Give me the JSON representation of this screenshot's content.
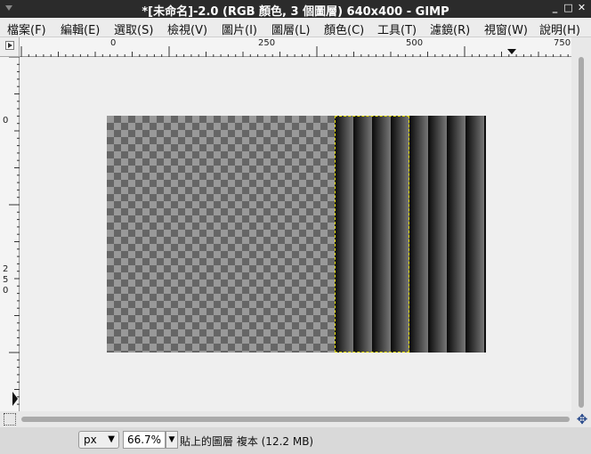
{
  "window": {
    "title": "*[未命名]-2.0 (RGB 顏色, 3 個圖層) 640x400 - GIMP",
    "controls": [
      "_",
      "□",
      "✕"
    ]
  },
  "menu": [
    "檔案(F)",
    "編輯(E)",
    "選取(S)",
    "檢視(V)",
    "圖片(I)",
    "圖層(L)",
    "顏色(C)",
    "工具(T)",
    "濾鏡(R)",
    "視窗(W)",
    "說明(H)"
  ],
  "rulers": {
    "horizontal_labels": [
      "0",
      "250",
      "500",
      "750"
    ],
    "vertical_labels": [
      "0",
      "2",
      "5",
      "0"
    ]
  },
  "status": {
    "unit": "px",
    "zoom": "66.7%",
    "message": "貼上的圖層 複本 (12.2 MB)"
  },
  "colors": {
    "selection_marquee": "#e8e000",
    "checker_dark": "#666666",
    "checker_light": "#999999"
  },
  "icons": [
    "ruler-corner-icon",
    "navigate-icon",
    "quickmask-icon",
    "chevron-down-icon"
  ]
}
